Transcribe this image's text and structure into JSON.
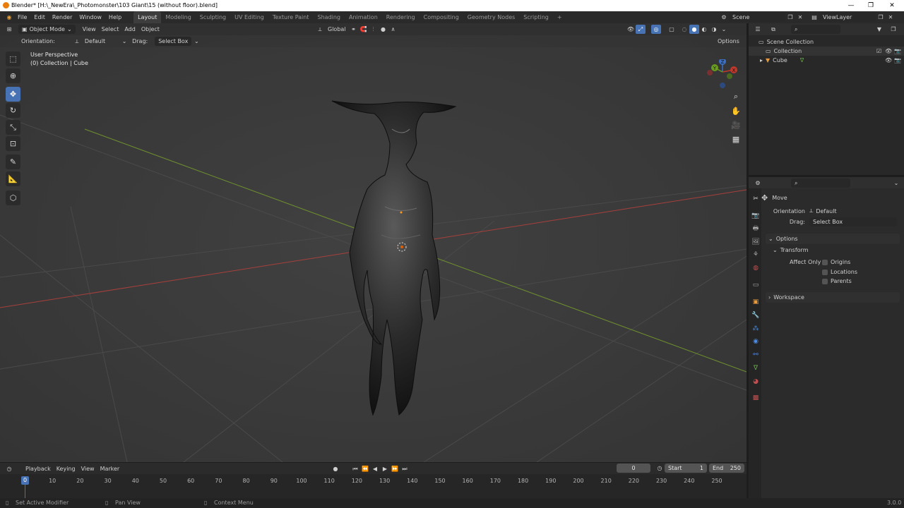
{
  "window": {
    "title": "Blender* [H:\\_NewEra\\_Photomonster\\103 Giant\\15 (without floor).blend]",
    "controls": [
      "—",
      "❐",
      "✕"
    ]
  },
  "menu": [
    "File",
    "Edit",
    "Render",
    "Window",
    "Help"
  ],
  "workspaces": [
    "Layout",
    "Modeling",
    "Sculpting",
    "UV Editing",
    "Texture Paint",
    "Shading",
    "Animation",
    "Rendering",
    "Compositing",
    "Geometry Nodes",
    "Scripting"
  ],
  "workspace_add": "+",
  "scene": {
    "name": "Scene",
    "view_layer": "ViewLayer"
  },
  "viewport_header": {
    "mode": "Object Mode",
    "menus": [
      "View",
      "Select",
      "Add",
      "Object"
    ],
    "transform_orientation": "Global"
  },
  "tool_header": {
    "orientation_label": "Orientation:",
    "orientation_value": "Default",
    "drag_label": "Drag:",
    "drag_value": "Select Box",
    "options": "Options"
  },
  "overlay_text": {
    "perspective": "User Perspective",
    "collection": "(0) Collection | Cube"
  },
  "gizmo": {
    "x": "X",
    "y": "Y",
    "z": "Z"
  },
  "outliner": {
    "root": "Scene Collection",
    "items": [
      {
        "label": "Collection",
        "type": "collection"
      },
      {
        "label": "Cube",
        "type": "mesh"
      }
    ]
  },
  "properties": {
    "tool_name": "Move",
    "orientation_label": "Orientation",
    "orientation_value": "Default",
    "drag_label": "Drag:",
    "drag_value": "Select Box",
    "options_panel": "Options",
    "transform_panel": "Transform",
    "affect_only_label": "Affect Only",
    "affect_options": [
      "Origins",
      "Locations",
      "Parents"
    ],
    "workspace_panel": "Workspace"
  },
  "timeline": {
    "menus": [
      "Playback",
      "Keying",
      "View",
      "Marker"
    ],
    "current_frame": "0",
    "start_label": "Start",
    "start_value": "1",
    "end_label": "End",
    "end_value": "250",
    "ticks": [
      "0",
      "10",
      "20",
      "30",
      "40",
      "50",
      "60",
      "70",
      "80",
      "90",
      "100",
      "110",
      "120",
      "130",
      "140",
      "150",
      "160",
      "170",
      "180",
      "190",
      "200",
      "210",
      "220",
      "230",
      "240",
      "250"
    ]
  },
  "statusbar": {
    "left": "Set Active Modifier",
    "middle": "Pan View",
    "right": "Context Menu",
    "version": "3.0.0"
  },
  "colors": {
    "accent": "#4772b3",
    "x_axis": "#c0392b",
    "y_axis": "#6a9a1f",
    "z_axis": "#3d6fc2"
  }
}
